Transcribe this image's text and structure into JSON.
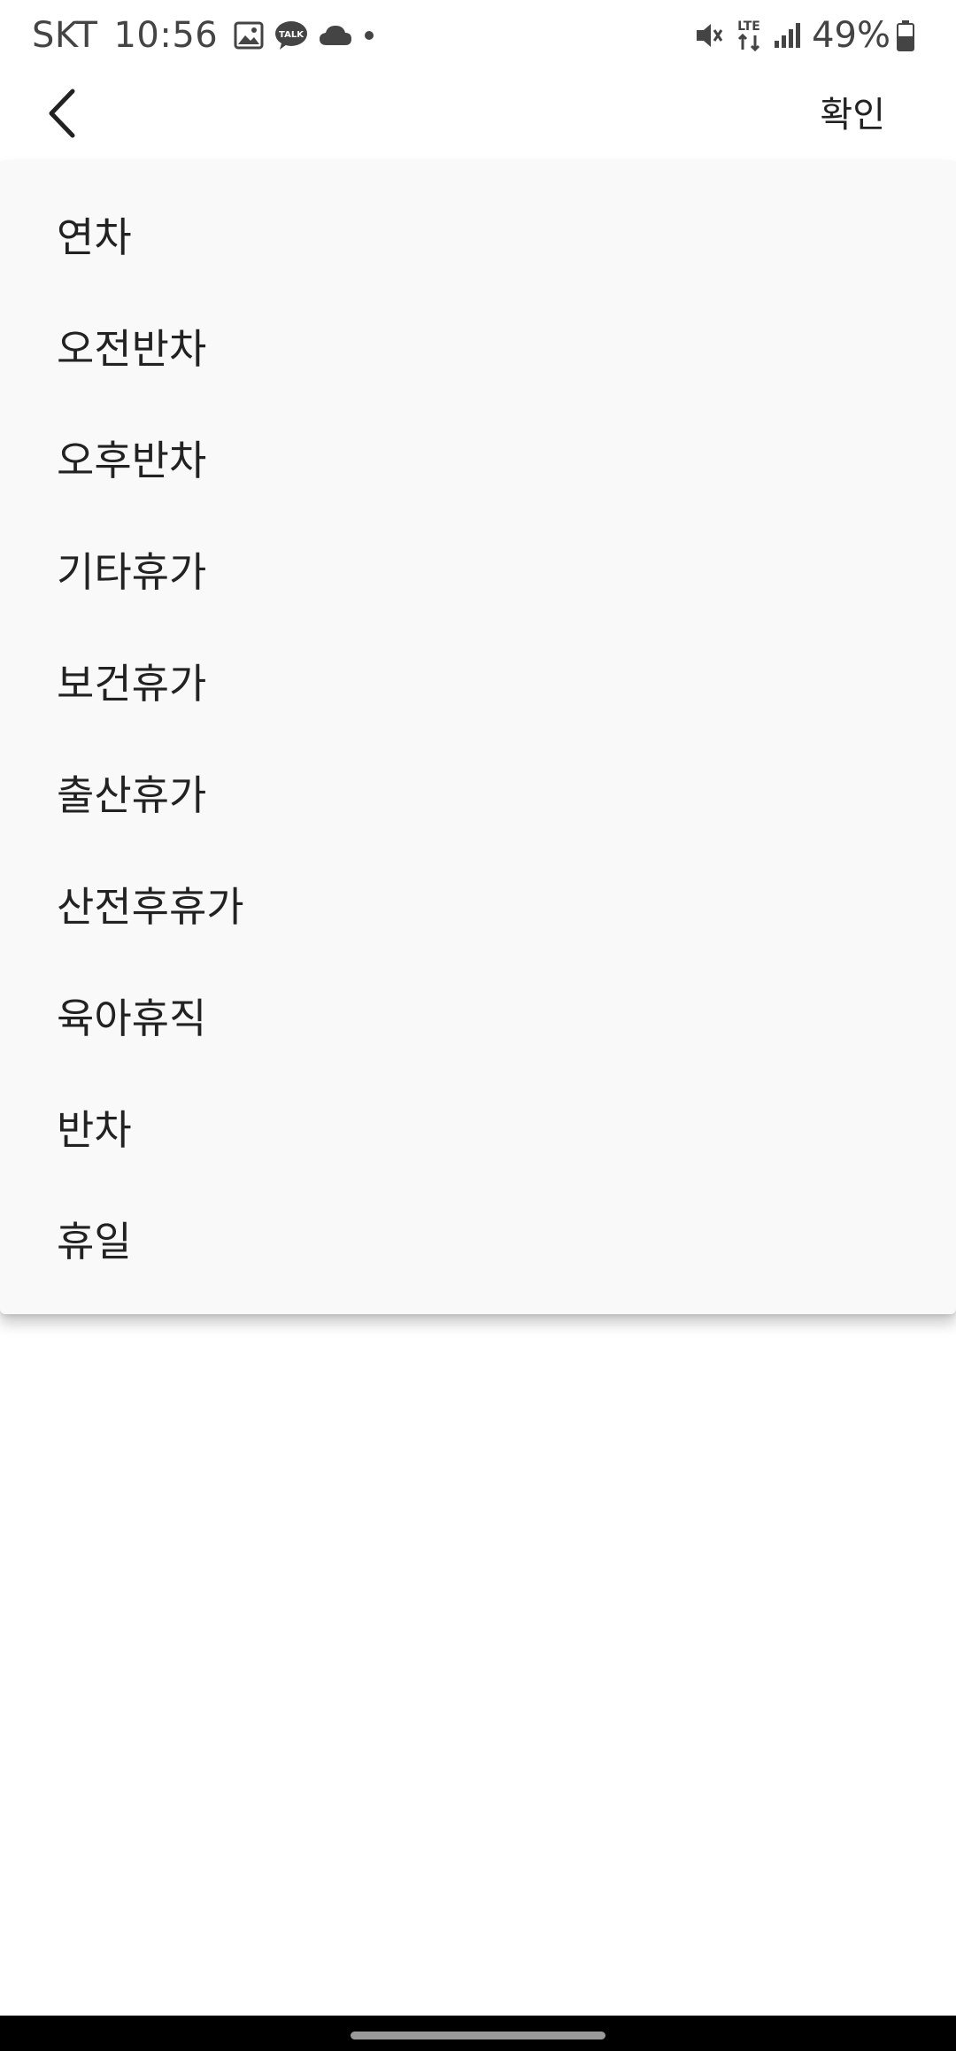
{
  "status_bar": {
    "carrier": "SKT",
    "time": "10:56",
    "left_icons": [
      "image-icon",
      "kakaotalk-icon",
      "cloud-icon",
      "dot-icon"
    ],
    "right_icons": [
      "vibrate-mute-icon",
      "lte-data-icon",
      "signal-icon",
      "battery-icon"
    ],
    "battery_percent": "49%",
    "network_label": "LTE",
    "talk_badge": "TALK"
  },
  "app_bar": {
    "back_icon": "chevron-left-icon",
    "confirm_label": "확인"
  },
  "dropdown": {
    "options": [
      {
        "label": "연차"
      },
      {
        "label": "오전반차"
      },
      {
        "label": "오후반차"
      },
      {
        "label": "기타휴가"
      },
      {
        "label": "보건휴가"
      },
      {
        "label": "출산휴가"
      },
      {
        "label": "산전후휴가"
      },
      {
        "label": "육아휴직"
      },
      {
        "label": "반차"
      },
      {
        "label": "휴일"
      }
    ]
  },
  "colors": {
    "background": "#ffffff",
    "dropdown_background": "#f9f9f9",
    "text": "#222222",
    "status_text": "#444444",
    "nav_bar": "#000000"
  }
}
